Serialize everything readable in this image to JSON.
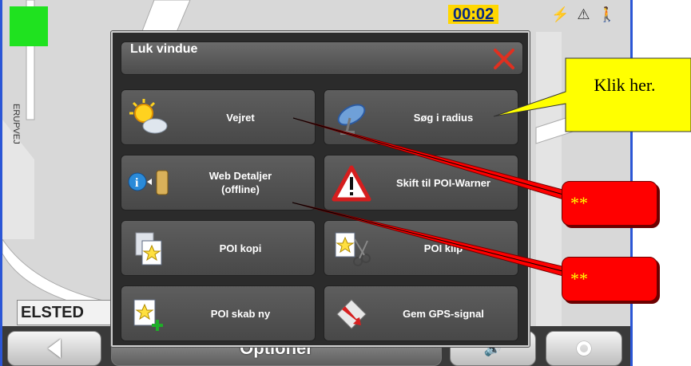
{
  "status": {
    "clock": "00:02"
  },
  "map": {
    "street_name": "ELSTED",
    "labels": [
      "ERUPVEJ"
    ]
  },
  "popup": {
    "title": "Luk vindue",
    "buttons": [
      {
        "label": "Vejret",
        "icon": "weather-icon"
      },
      {
        "label": "Søg i radius",
        "icon": "satellite-dish-icon"
      },
      {
        "label": "Web Detaljer\n(offline)",
        "icon": "web-details-icon"
      },
      {
        "label": "Skift til POI-Warner",
        "icon": "warning-icon"
      },
      {
        "label": "POI kopi",
        "icon": "poi-copy-icon"
      },
      {
        "label": "POI klip",
        "icon": "poi-cut-icon"
      },
      {
        "label": "POI skab ny",
        "icon": "poi-new-icon"
      },
      {
        "label": "Gem GPS-signal",
        "icon": "gps-save-icon"
      }
    ]
  },
  "bottom_bar": {
    "options_label": "Optioner"
  },
  "annotations": {
    "callout_text": "Klik her.",
    "notes": [
      "**",
      "**"
    ]
  },
  "colors": {
    "gps": "#1fe21f",
    "clock_bg": "#ffd700",
    "callout": "#ffff00",
    "note": "#ff0000"
  }
}
